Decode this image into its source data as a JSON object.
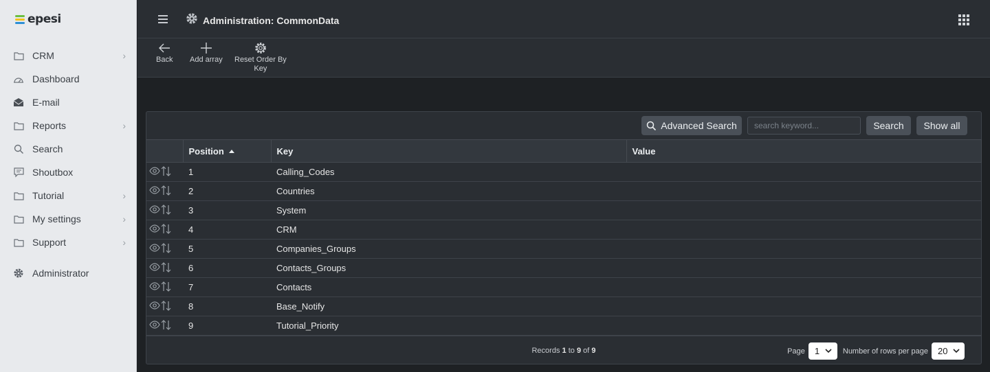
{
  "app": {
    "logo_text": "epesi"
  },
  "sidebar": {
    "items": [
      {
        "label": "CRM",
        "has_children": true
      },
      {
        "label": "Dashboard",
        "has_children": false
      },
      {
        "label": "E-mail",
        "has_children": false
      },
      {
        "label": "Reports",
        "has_children": true
      },
      {
        "label": "Search",
        "has_children": false
      },
      {
        "label": "Shoutbox",
        "has_children": false
      },
      {
        "label": "Tutorial",
        "has_children": true
      },
      {
        "label": "My settings",
        "has_children": true
      },
      {
        "label": "Support",
        "has_children": true
      }
    ],
    "admin_label": "Administrator"
  },
  "header": {
    "title": "Administration: CommonData"
  },
  "actions": {
    "back_label": "Back",
    "add_array_label": "Add array",
    "reset_order_label_line1": "Reset Order By",
    "reset_order_label_line2": "Key"
  },
  "search": {
    "advanced_label": "Advanced Search",
    "placeholder": "search keyword...",
    "search_label": "Search",
    "show_all_label": "Show all"
  },
  "table": {
    "headers": {
      "position": "Position",
      "key": "Key",
      "value": "Value"
    },
    "rows": [
      {
        "position": "1",
        "key": "Calling_Codes",
        "value": ""
      },
      {
        "position": "2",
        "key": "Countries",
        "value": ""
      },
      {
        "position": "3",
        "key": "System",
        "value": ""
      },
      {
        "position": "4",
        "key": "CRM",
        "value": ""
      },
      {
        "position": "5",
        "key": "Companies_Groups",
        "value": ""
      },
      {
        "position": "6",
        "key": "Contacts_Groups",
        "value": ""
      },
      {
        "position": "7",
        "key": "Contacts",
        "value": ""
      },
      {
        "position": "8",
        "key": "Base_Notify",
        "value": ""
      },
      {
        "position": "9",
        "key": "Tutorial_Priority",
        "value": ""
      }
    ]
  },
  "footer": {
    "records_prefix": "Records",
    "records_from": "1",
    "records_to_word": "to",
    "records_to": "9",
    "records_of_word": "of",
    "records_total": "9",
    "page_label": "Page",
    "page_value": "1",
    "rows_per_page_label": "Number of rows per page",
    "rows_per_page_value": "20"
  },
  "colors": {
    "logo_green": "#6cbf3e",
    "logo_yellow": "#f2c21b",
    "logo_blue": "#2d8fd5"
  }
}
